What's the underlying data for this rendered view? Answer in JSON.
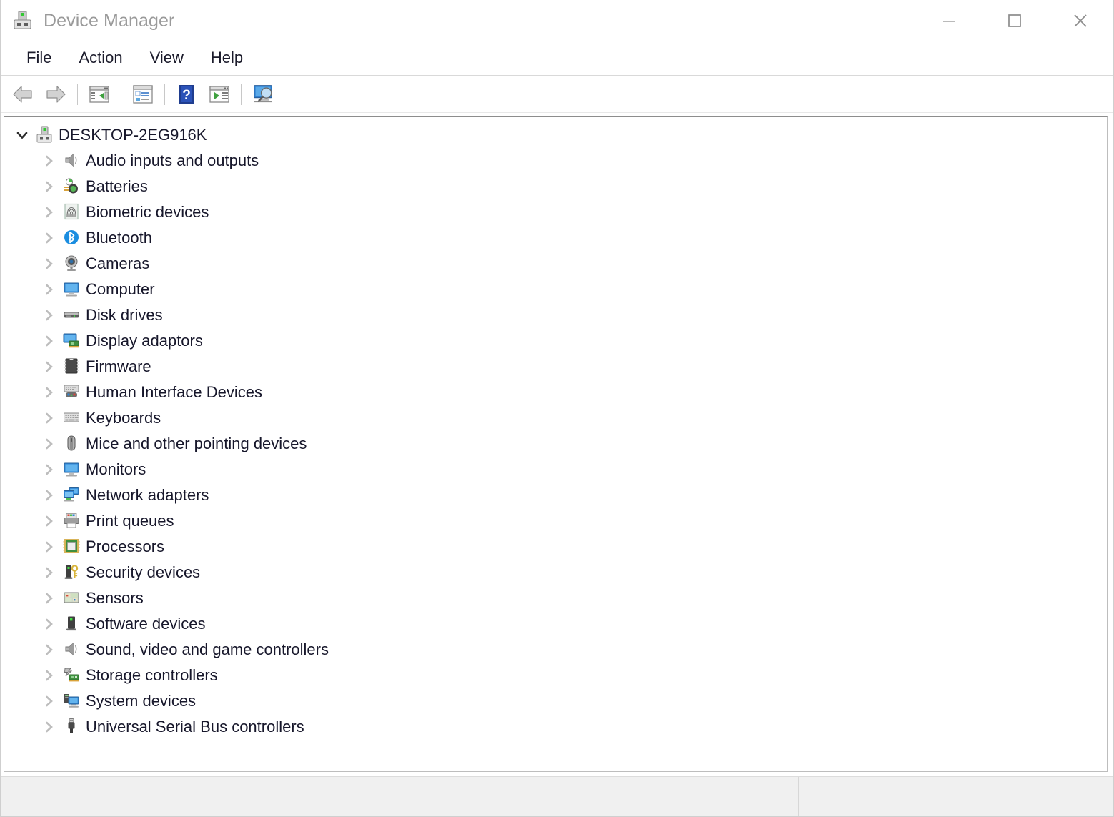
{
  "window": {
    "title": "Device Manager",
    "app_icon": "device-manager-icon",
    "controls": {
      "minimize": "minimize-icon",
      "maximize": "maximize-icon",
      "close": "close-icon"
    }
  },
  "menubar": {
    "items": [
      {
        "label": "File"
      },
      {
        "label": "Action"
      },
      {
        "label": "View"
      },
      {
        "label": "Help"
      }
    ]
  },
  "toolbar": {
    "items": [
      {
        "icon": "back-arrow-icon",
        "label": "Back"
      },
      {
        "icon": "forward-arrow-icon",
        "label": "Forward"
      },
      {
        "separator": true
      },
      {
        "icon": "show-hide-console-tree-icon",
        "label": "Show/Hide Console Tree"
      },
      {
        "separator": true
      },
      {
        "icon": "properties-icon",
        "label": "Properties"
      },
      {
        "separator": true
      },
      {
        "icon": "help-icon",
        "label": "Help"
      },
      {
        "icon": "update-driver-icon",
        "label": "Update Driver"
      },
      {
        "separator": true
      },
      {
        "icon": "scan-for-hardware-changes-icon",
        "label": "Scan for hardware changes"
      }
    ]
  },
  "tree": {
    "root": {
      "label": "DESKTOP-2EG916K",
      "icon": "computer-device-icon",
      "expanded": true,
      "chevron": "chevron-down-icon"
    },
    "children": [
      {
        "label": "Audio inputs and outputs",
        "icon": "speaker-icon"
      },
      {
        "label": "Batteries",
        "icon": "battery-icon"
      },
      {
        "label": "Biometric devices",
        "icon": "fingerprint-icon"
      },
      {
        "label": "Bluetooth",
        "icon": "bluetooth-icon"
      },
      {
        "label": "Cameras",
        "icon": "camera-icon"
      },
      {
        "label": "Computer",
        "icon": "monitor-icon"
      },
      {
        "label": "Disk drives",
        "icon": "disk-drive-icon"
      },
      {
        "label": "Display adaptors",
        "icon": "display-adapter-icon"
      },
      {
        "label": "Firmware",
        "icon": "chip-icon"
      },
      {
        "label": "Human Interface Devices",
        "icon": "hid-gamepad-icon"
      },
      {
        "label": "Keyboards",
        "icon": "keyboard-icon"
      },
      {
        "label": "Mice and other pointing devices",
        "icon": "mouse-icon"
      },
      {
        "label": "Monitors",
        "icon": "monitor-icon"
      },
      {
        "label": "Network adapters",
        "icon": "network-adapter-icon"
      },
      {
        "label": "Print queues",
        "icon": "printer-icon"
      },
      {
        "label": "Processors",
        "icon": "processor-icon"
      },
      {
        "label": "Security devices",
        "icon": "security-key-icon"
      },
      {
        "label": "Sensors",
        "icon": "sensor-icon"
      },
      {
        "label": "Software devices",
        "icon": "software-device-icon"
      },
      {
        "label": "Sound, video and game controllers",
        "icon": "speaker-icon"
      },
      {
        "label": "Storage controllers",
        "icon": "storage-controller-icon"
      },
      {
        "label": "System devices",
        "icon": "system-device-icon"
      },
      {
        "label": "Universal Serial Bus controllers",
        "icon": "usb-icon"
      }
    ],
    "child_chevron": "chevron-right-icon"
  },
  "statusbar": {
    "panes": [
      "",
      "",
      ""
    ]
  },
  "colors": {
    "title_text": "#9a9a9a",
    "menu_text": "#1b1b2b",
    "tree_text": "#17172b",
    "statusbar_bg": "#f0f0f0",
    "bluetooth_blue": "#1a8de0",
    "accent_green": "#32c832"
  }
}
